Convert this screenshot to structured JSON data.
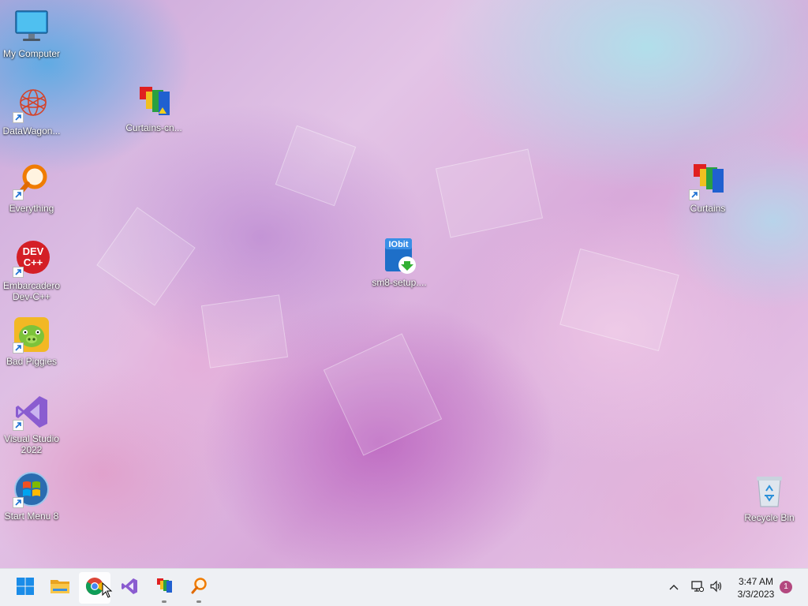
{
  "desktop": {
    "icons": [
      {
        "label": "My Computer",
        "icon": "monitor-icon"
      },
      {
        "label": "DataWagon...",
        "icon": "datawagon-icon"
      },
      {
        "label": "Everything",
        "icon": "magnifier-icon"
      },
      {
        "label": "Embarcadero Dev-C++",
        "icon": "devcpp-icon",
        "logo_text": "DEV\nC++"
      },
      {
        "label": "Bad Piggies",
        "icon": "bad-piggies-icon"
      },
      {
        "label": "Visual Studio 2022",
        "icon": "visual-studio-icon"
      },
      {
        "label": "Start Menu 8",
        "icon": "start-menu-orb-icon"
      },
      {
        "label": "Curtains-cn...",
        "icon": "curtains-icon"
      },
      {
        "label": "sm8-setup....",
        "icon": "iobit-installer-icon",
        "logo_text": "IObit"
      },
      {
        "label": "Curtains",
        "icon": "curtains-icon"
      },
      {
        "label": "Recycle Bin",
        "icon": "recycle-bin-icon"
      }
    ]
  },
  "taskbar": {
    "apps": [
      {
        "name": "Start",
        "icon": "windows-start-icon"
      },
      {
        "name": "File Explorer",
        "icon": "folder-icon"
      },
      {
        "name": "Google Chrome",
        "icon": "chrome-icon"
      },
      {
        "name": "Visual Studio",
        "icon": "visual-studio-icon"
      },
      {
        "name": "Curtains",
        "icon": "curtains-icon"
      },
      {
        "name": "Everything",
        "icon": "magnifier-icon"
      }
    ],
    "clock": {
      "time": "3:47 AM",
      "date": "3/3/2023"
    },
    "notification_count": "1"
  },
  "colors": {
    "taskbar_bg": "#eef0f4",
    "accent_blue": "#0078d4",
    "badge": "#b3487f"
  }
}
